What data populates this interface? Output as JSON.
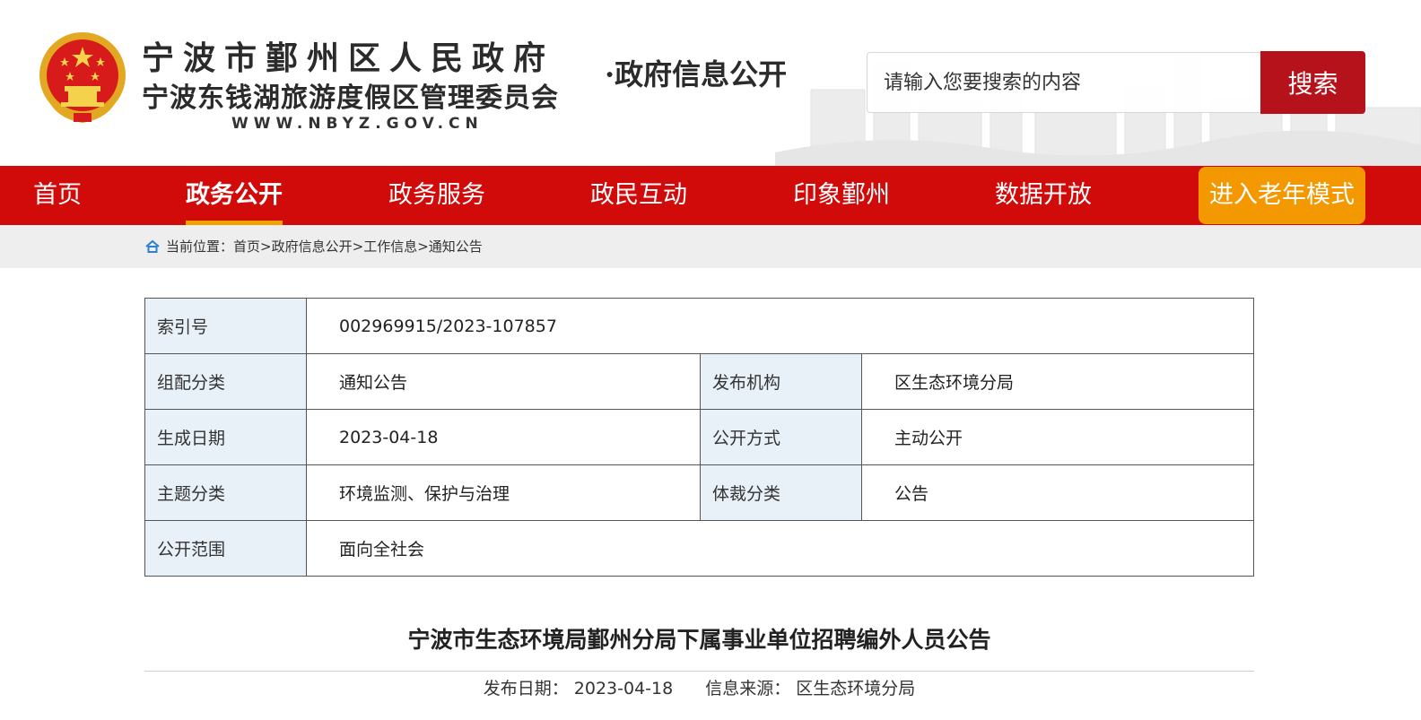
{
  "header": {
    "title_line1": "宁波市鄞州区人民政府",
    "title_line2": "宁波东钱湖旅游度假区管理委员会",
    "url": "WWW.NBYZ.GOV.CN",
    "suffix": "·政府信息公开",
    "emblem_icon": "national-emblem-icon",
    "search_placeholder": "请输入您要搜索的内容",
    "search_label": "搜索"
  },
  "nav": {
    "items": [
      {
        "label": "首页"
      },
      {
        "label": "政务公开"
      },
      {
        "label": "政务服务"
      },
      {
        "label": "政民互动"
      },
      {
        "label": "印象鄞州"
      },
      {
        "label": "数据开放"
      }
    ],
    "active_index": 1,
    "elder_label": "进入老年模式"
  },
  "breadcrumb": {
    "prefix": "当前位置：",
    "items": [
      "首页",
      "政府信息公开",
      "工作信息",
      "通知公告"
    ],
    "separator": ">"
  },
  "meta": {
    "index_label": "索引号",
    "index_value": "002969915/2023-107857",
    "category_label": "组配分类",
    "category_value": "通知公告",
    "publisher_label": "发布机构",
    "publisher_value": "区生态环境分局",
    "date_label": "生成日期",
    "date_value": "2023-04-18",
    "mode_label": "公开方式",
    "mode_value": "主动公开",
    "topic_label": "主题分类",
    "topic_value": "环境监测、保护与治理",
    "genre_label": "体裁分类",
    "genre_value": "公告",
    "scope_label": "公开范围",
    "scope_value": "面向全社会"
  },
  "article": {
    "title": "宁波市生态环境局鄞州分局下属事业单位招聘编外人员公告",
    "date_label": "发布日期：",
    "date_value": "2023-04-18",
    "source_label": "信息来源：",
    "source_value": "区生态环境分局"
  },
  "colors": {
    "nav_red": "#d10a0a",
    "search_red": "#b5121b",
    "accent_orange": "#f39800",
    "meta_key_bg": "#e8f0f8"
  }
}
